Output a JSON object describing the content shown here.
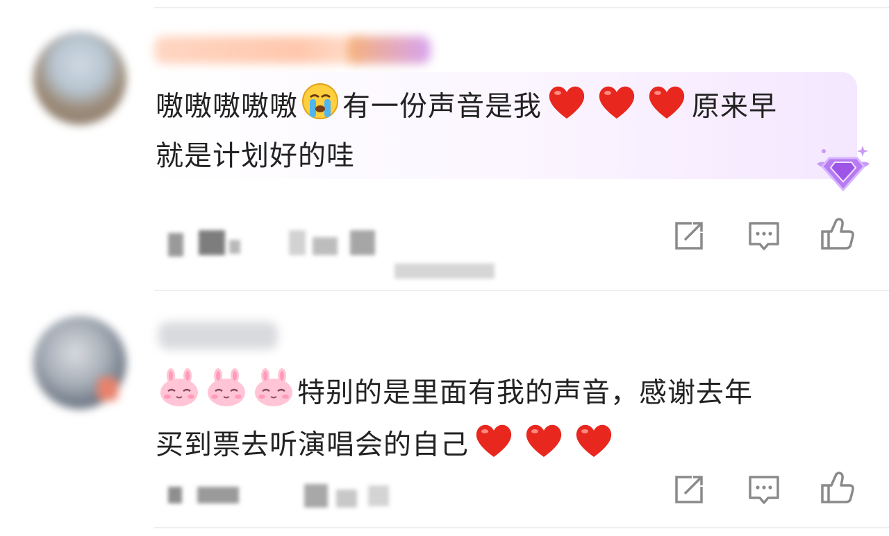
{
  "comments": [
    {
      "text_lines": [
        "嗷嗷嗷嗷嗷",
        "有一份声音是我",
        "原来早",
        "就是计划好的哇"
      ],
      "leading_emoji": "loudly-crying-face",
      "hearts_inline": 3,
      "badge": "purple-diamond-badge",
      "actions": {
        "share": "share-icon",
        "comment": "comment-icon",
        "like": "thumbs-up-icon"
      }
    },
    {
      "text_lines": [
        "特别的是里面有我的声音，感谢去年",
        "买到票去听演唱会的自己"
      ],
      "leading_emoji": "pink-bunny-sticker",
      "leading_emoji_count": 3,
      "hearts_trailing": 3,
      "actions": {
        "share": "share-icon",
        "comment": "comment-icon",
        "like": "thumbs-up-icon"
      }
    }
  ],
  "colors": {
    "heart": "#e8271e",
    "bubble_tint": "#f4e7ff",
    "divider": "#efefef",
    "icon_gray": "#8a8a8a"
  }
}
